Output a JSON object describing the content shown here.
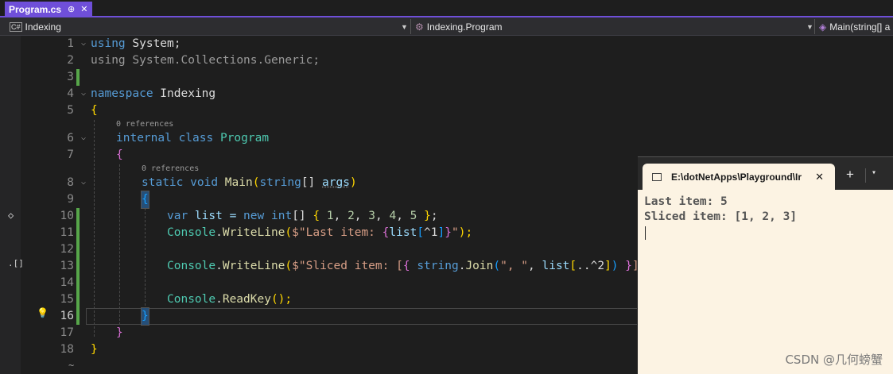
{
  "tab": {
    "title": "Program.cs",
    "pin": "⊕",
    "close": "✕"
  },
  "navbar": {
    "project": "Indexing",
    "project_icon": "C#",
    "type": "Indexing.Program",
    "member": "Main(string[] a"
  },
  "code": {
    "refs": "0 references",
    "lines": [
      "1",
      "2",
      "3",
      "4",
      "5",
      "6",
      "7",
      "8",
      "9",
      "10",
      "11",
      "12",
      "13",
      "14",
      "15",
      "16",
      "17",
      "18"
    ],
    "l1": [
      "using",
      " System;"
    ],
    "l2": "using System.Collections.Generic;",
    "l4": [
      "namespace",
      " Indexing"
    ],
    "l5": "{",
    "l6": [
      "internal",
      " ",
      "class",
      " ",
      "Program"
    ],
    "l7": "{",
    "l8": [
      "static",
      " ",
      "void",
      " ",
      "Main",
      "(",
      "string",
      "[] ",
      "args",
      ")"
    ],
    "l9": "{",
    "l10": [
      "var",
      " list = ",
      "new",
      " ",
      "int",
      "[] ",
      "{",
      " ",
      "1",
      ", ",
      "2",
      ", ",
      "3",
      ", ",
      "4",
      ", ",
      "5",
      " ",
      "}",
      ";"
    ],
    "l11": [
      "Console",
      ".",
      "WriteLine",
      "(",
      "$\"Last item: ",
      "{",
      "list",
      "[",
      "^1",
      "]",
      "}",
      "\"",
      ");"
    ],
    "l13": [
      "Console",
      ".",
      "WriteLine",
      "(",
      "$\"Sliced item: [",
      "{",
      " ",
      "string",
      ".",
      "Join",
      "(",
      "\", \"",
      ", ",
      "list",
      "[",
      "..^2",
      "]",
      ") ",
      "}",
      "]\"",
      ");"
    ],
    "l15": [
      "Console",
      ".",
      "ReadKey",
      "();"
    ],
    "l16": "}",
    "l17": "}",
    "l18": "}",
    "tilde": "~"
  },
  "terminal": {
    "title": "E:\\dotNetApps\\Playground\\Ir",
    "close": "✕",
    "plus": "+",
    "chevron": "⌄",
    "output": [
      "Last item: 5",
      "Sliced item: [1, 2, 3]"
    ]
  },
  "watermark": "CSDN @几何螃蟹"
}
